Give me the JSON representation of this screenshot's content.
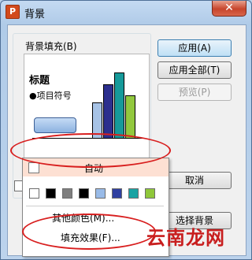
{
  "window": {
    "title": "背景",
    "app_icon": "P",
    "close_glyph": "✕"
  },
  "background_fill": {
    "group_label": "背景填充(B)",
    "preview": {
      "title": "标题",
      "bullet_text": "●项目符号"
    },
    "color_combo_value": ""
  },
  "buttons": {
    "apply": "应用(A)",
    "apply_all": "应用全部(T)",
    "preview": "预览(P)",
    "cancel": "取消",
    "choose_background": "选择背景"
  },
  "color_menu": {
    "auto_label": "自动",
    "swatches": [
      "#ffffff",
      "#000000",
      "#7f7f7f",
      "#000000",
      "#99bbe8",
      "#2f3fa0",
      "#1aa3a3",
      "#8fc73a"
    ],
    "more_colors": "其他颜色(M)...",
    "fill_effects": "填充效果(F)..."
  },
  "preview_chart": {
    "bar_colors": [
      "#a7c3e6",
      "#2c2f8e",
      "#169a9a",
      "#92c83e"
    ],
    "bar_levels": [
      0.55,
      0.82,
      1.0,
      0.65
    ]
  },
  "watermark": "云南龙网"
}
